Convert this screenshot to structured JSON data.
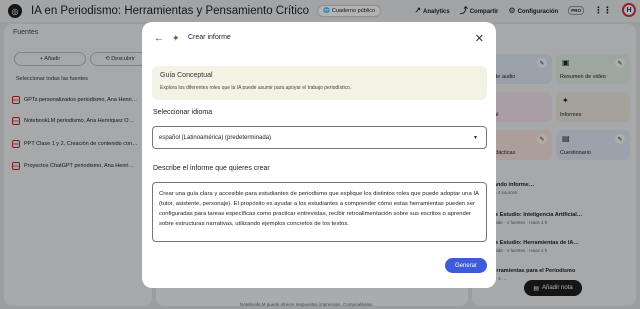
{
  "header": {
    "title": "IA en Periodismo: Herramientas y Pensamiento Crítico",
    "public_chip": "Cuaderno público",
    "analytics": "Analytics",
    "share": "Compartir",
    "settings": "Configuración",
    "pro": "PRO",
    "avatar_letter": "H"
  },
  "sources": {
    "title": "Fuentes",
    "add": "+ Añadir",
    "discover": "Descubrir",
    "select_all": "Seleccionar todas las fuentes",
    "items": [
      "GPTs personalizados periodismo, Ana Henri…",
      "NotebookLM periodismo, Ana Henriquez O…",
      "PPT Clase 1 y 2, Creación de contenido con…",
      "Proyectos ChatGPT periodismo, Ana Henri…"
    ]
  },
  "studio": {
    "tiles": [
      {
        "label": "men de audio"
      },
      {
        "label": "Resumen de video"
      },
      {
        "label": "mental"
      },
      {
        "label": "Informes"
      },
      {
        "label": "tas didácticas"
      },
      {
        "label": "Cuestionario"
      }
    ],
    "notes": [
      {
        "title": "Generando informe…",
        "sub": "based on 4 sources"
      },
      {
        "title": "Guía de Estudio: Inteligencia Artificial…",
        "sub": "Study Guide · 4 fuentes · Hace 4 h"
      },
      {
        "title": "Guía de Estudio: Herramientas de IA…",
        "sub": "Study Guide · 4 fuentes · Hace 4 h"
      },
      {
        "title": "IA y Herramientas para el Periodismo",
        "sub": "Fuentes · 4 …"
      }
    ],
    "add_note": "Añadir nota"
  },
  "footnote": "NotebookLM puede ofrecer respuestas imprecisas. Compruébalas.",
  "modal": {
    "title": "Crear informe",
    "guide_title": "Guía Conceptual",
    "guide_desc": "Explora los diferentes roles que la IA puede asumir para apoyar el trabajo periodístico.",
    "language_label": "Seleccionar idioma",
    "language_value": "español (Latinoamérica) (predeterminada)",
    "prompt_label": "Describe el informe que quieres crear",
    "prompt_value": "Crear una guía clara y accesible para estudiantes de periodismo que explique los distintos roles que puede adoptar una IA (tutor, asistente, personaje). El propósito es ayudar a los estudiantes a comprender cómo estas herramientas pueden ser configuradas para tareas específicas como practicar entrevistas, recibir retroalimentación sobre sus escritos o aprender sobre estructuras narrativas, utilizando ejemplos concretos de los textos.",
    "generate": "Generar"
  },
  "colors": {
    "primary_button": "#3d5dd8",
    "guide_card": "#f2f3e5",
    "scrim": "rgba(0,0,0,0.30)"
  }
}
